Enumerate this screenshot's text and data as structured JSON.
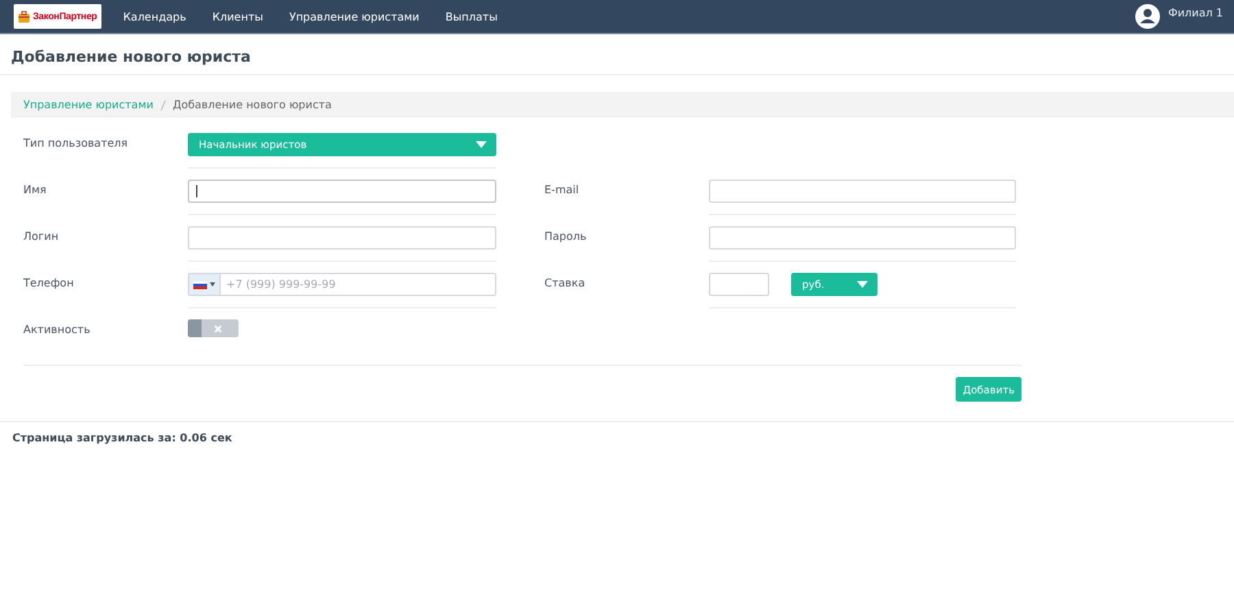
{
  "navbar": {
    "logo": "ЗаконПартнер",
    "items": [
      {
        "label": "Календарь"
      },
      {
        "label": "Клиенты"
      },
      {
        "label": "Управление юристами"
      },
      {
        "label": "Выплаты"
      }
    ],
    "user": "Филиал 1"
  },
  "page_title": "Добавление нового юриста",
  "breadcrumb": [
    {
      "label": "Управление юристами",
      "kind": "link"
    },
    {
      "label": "Добавление нового юриста",
      "kind": "current"
    }
  ],
  "form": {
    "rows": [
      {
        "fields": [
          {
            "label": "Тип пользователя",
            "kind": "select",
            "value": "Начальник юристов"
          }
        ]
      },
      {
        "fields": [
          {
            "label": "Имя",
            "kind": "text",
            "focused": true
          },
          {
            "label": "E-mail",
            "kind": "text",
            "focused": false
          }
        ]
      },
      {
        "fields": [
          {
            "label": "Логин",
            "kind": "text",
            "focused": false
          },
          {
            "label": "Пароль",
            "kind": "text",
            "focused": false
          }
        ]
      },
      {
        "fields": [
          {
            "label": "Телефон",
            "kind": "phone",
            "placeholder": "+7 (999) 999-99-99"
          },
          {
            "label": "Ставка",
            "kind": "rate",
            "currency": "руб."
          }
        ]
      },
      {
        "fields": [
          {
            "label": "Активность",
            "kind": "toggle",
            "on": false
          }
        ]
      }
    ],
    "submit": "Добавить"
  },
  "footer": "Страница загрузилась за: 0.06 сек"
}
